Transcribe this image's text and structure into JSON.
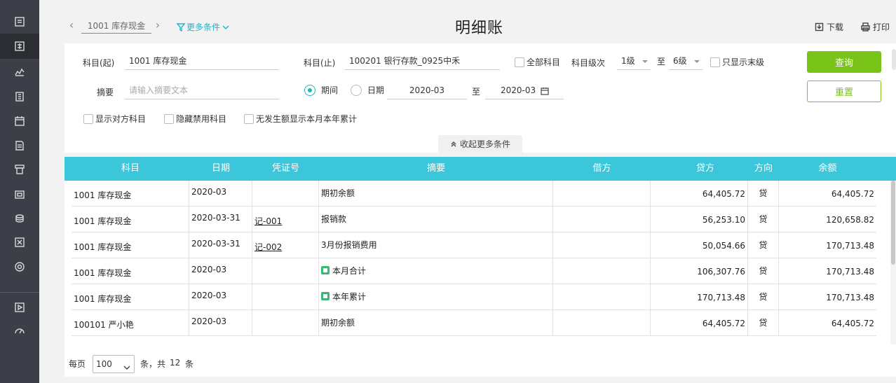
{
  "header": {
    "current_subject": "1001  库存现金",
    "more_conditions": "更多条件",
    "title": "明细账",
    "download": "下载",
    "print": "打印"
  },
  "filters": {
    "subject_from_label": "科目(起)",
    "subject_from_value": "1001  库存现金",
    "subject_to_label": "科目(止)",
    "subject_to_value": "100201  银行存款_0925中禾",
    "all_subjects_label": "全部科目",
    "level_label": "科目级次",
    "level_from": "1级",
    "level_to_sep": "至",
    "level_to": "6级",
    "leaf_only_label": "只显示末级",
    "summary_label": "摘要",
    "summary_placeholder": "请输入摘要文本",
    "period_label": "期间",
    "date_label": "日期",
    "period_from": "2020-03",
    "period_to_sep": "至",
    "period_to": "2020-03",
    "show_counter_label": "显示对方科目",
    "hide_disabled_label": "隐藏禁用科目",
    "no_amount_label": "无发生额显示本月本年累计",
    "query_button": "查询",
    "reset_button": "重置",
    "collapse_label": "收起更多条件"
  },
  "table": {
    "columns": [
      "科目",
      "日期",
      "凭证号",
      "摘要",
      "借方",
      "贷方",
      "方向",
      "余额"
    ],
    "rows": [
      {
        "subject": "1001 库存现金",
        "date": "2020-03",
        "voucher": "",
        "summary": "期初余额",
        "badge": false,
        "debit": "",
        "credit": "64,405.72",
        "direction": "贷",
        "balance": "64,405.72"
      },
      {
        "subject": "1001 库存现金",
        "date": "2020-03-31",
        "voucher": "记-001",
        "summary": "报销款",
        "badge": false,
        "debit": "",
        "credit": "56,253.10",
        "direction": "贷",
        "balance": "120,658.82"
      },
      {
        "subject": "1001 库存现金",
        "date": "2020-03-31",
        "voucher": "记-002",
        "summary": "3月份报销费用",
        "badge": false,
        "debit": "",
        "credit": "50,054.66",
        "direction": "贷",
        "balance": "170,713.48"
      },
      {
        "subject": "1001 库存现金",
        "date": "2020-03",
        "voucher": "",
        "summary": "本月合计",
        "badge": true,
        "debit": "",
        "credit": "106,307.76",
        "direction": "贷",
        "balance": "170,713.48"
      },
      {
        "subject": "1001 库存现金",
        "date": "2020-03",
        "voucher": "",
        "summary": "本年累计",
        "badge": true,
        "debit": "",
        "credit": "170,713.48",
        "direction": "贷",
        "balance": "170,713.48"
      },
      {
        "subject": "100101 严小艳",
        "date": "2020-03",
        "voucher": "",
        "summary": "期初余额",
        "badge": false,
        "debit": "",
        "credit": "64,405.72",
        "direction": "贷",
        "balance": "64,405.72"
      }
    ]
  },
  "pager": {
    "per_page_label": "每页",
    "page_size": "100",
    "total_prefix": "条，共",
    "total": "12",
    "total_suffix": "条"
  },
  "colors": {
    "accent": "#3cc6da",
    "primary_button": "#7ac41a",
    "rail": "#3c3f47"
  }
}
